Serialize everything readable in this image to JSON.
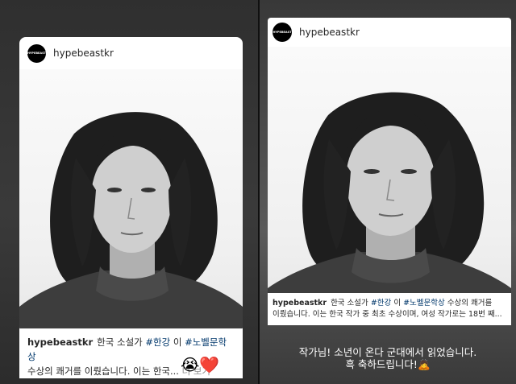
{
  "left_story": {
    "username": "hypebeastkr",
    "avatar_text": "HYPEBEAST",
    "caption": {
      "user": "hypebeastkr",
      "text1": "한국 소설가",
      "tag1": "#한강",
      "text2": "이",
      "tag2": "#노벨문학상",
      "line2": "수상의 쾌거를 이뤘습니다. 이는 한국...",
      "more": "더 보기"
    },
    "reaction_emojis": "😭❤️"
  },
  "right_story": {
    "username": "hypebeastkr",
    "avatar_text": "HYPEBEAST",
    "caption": {
      "user": "hypebeastkr",
      "text1": "한국 소설가",
      "tag1": "#한강",
      "text2": "이",
      "tag2": "#노벨문학상",
      "text3": "수상의 쾌거를",
      "line2": "이뤘습니다. 이는 한국 작가 중 최초 수상이며, 여성 작가로는 18번 째..."
    },
    "reply_line1": "작가님! 소년이 온다 군대에서 읽었습니다.",
    "reply_line2": "흑 축하드립니다!",
    "reply_emoji": "🙇"
  },
  "colors": {
    "hashtag": "#00376b",
    "more": "#8e8e8e",
    "reply_text": "#ffffff"
  }
}
